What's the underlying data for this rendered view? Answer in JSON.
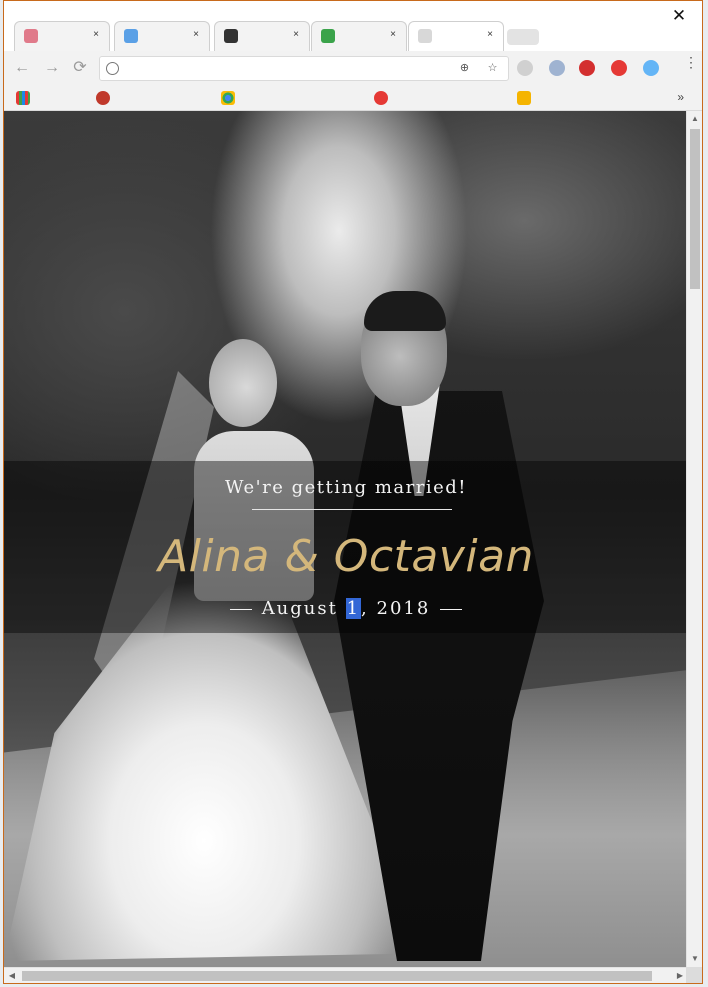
{
  "browser": {
    "tabs": [
      {
        "title": "",
        "favicon_color": "#e07a8a"
      },
      {
        "title": "",
        "favicon_color": "#5aa0e6"
      },
      {
        "title": "",
        "favicon_color": "#333333"
      },
      {
        "title": "",
        "favicon_color": "#3aa34a"
      },
      {
        "title": "",
        "favicon_color": "#d8d8d8"
      }
    ],
    "close_label": "×",
    "window_close_label": "✕",
    "nav": {
      "back": "←",
      "forward": "→",
      "reload": "⟳"
    },
    "url": "",
    "menu_label": "⋮",
    "bookmarks_more": "»",
    "bookmark_icons": [
      "#e53935",
      "#c0392b",
      "#4285f4",
      "#e53935",
      "#f5b400"
    ]
  },
  "page": {
    "tagline": "We're getting married!",
    "names": "Alina & Octavian",
    "date_prefix": "August ",
    "date_selected": "1",
    "date_suffix": ", 2018",
    "accent_color": "#d4b77b"
  }
}
